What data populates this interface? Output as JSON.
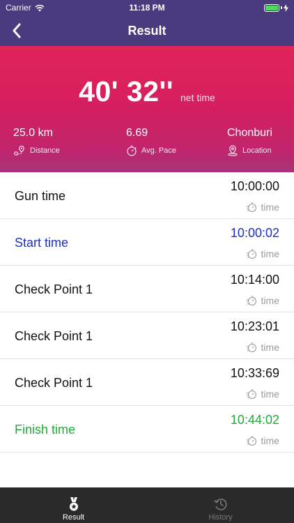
{
  "status_bar": {
    "carrier": "Carrier",
    "clock": "11:18 PM"
  },
  "nav": {
    "title": "Result"
  },
  "summary": {
    "net_time": "40' 32''",
    "net_time_label": "net time",
    "distance_value": "25.0 km",
    "distance_label": "Distance",
    "pace_value": "6.69",
    "pace_label": "Avg. Pace",
    "location_value": "Chonburi",
    "location_label": "Location"
  },
  "rows": [
    {
      "name": "Gun time",
      "time": "10:00:00",
      "tag": "time"
    },
    {
      "name": "Start time",
      "time": "10:00:02",
      "tag": "time"
    },
    {
      "name": "Check Point 1",
      "time": "10:14:00",
      "tag": "time"
    },
    {
      "name": "Check Point 1",
      "time": "10:23:01",
      "tag": "time"
    },
    {
      "name": "Check Point 1",
      "time": "10:33:69",
      "tag": "time"
    },
    {
      "name": "Finish time",
      "time": "10:44:02",
      "tag": "time"
    }
  ],
  "tabs": [
    {
      "label": "Result",
      "icon": "medal-icon"
    },
    {
      "label": "History",
      "icon": "history-icon"
    }
  ],
  "colors": {
    "header_purple": "#4a3a7e",
    "hero_pink": "#e1245a",
    "start_blue": "#1d2fc4",
    "finish_green": "#22a83a",
    "battery_green": "#4cd964",
    "tabbar": "#2a2a2a"
  }
}
